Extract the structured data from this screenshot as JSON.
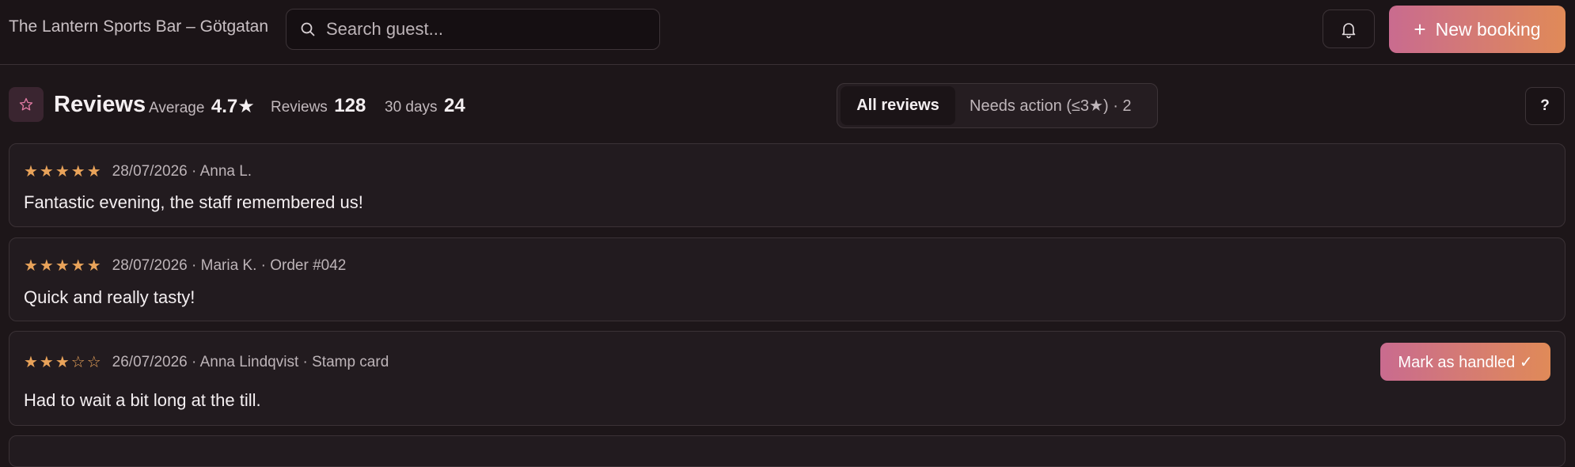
{
  "header": {
    "venue": "The Lantern Sports Bar – Götgatan",
    "search_placeholder": "Search guest...",
    "new_booking_label": "New booking",
    "new_booking_icon": "plus-icon",
    "bell_icon": "bell-icon"
  },
  "reviews_header": {
    "title": "Reviews",
    "average_label": "Average",
    "average_value": "4.7★",
    "reviews_label": "Reviews",
    "reviews_value": "128",
    "days_label": "30 days",
    "days_value": "24",
    "tabs": [
      {
        "label": "All reviews",
        "active": true
      },
      {
        "label": "Needs action (≤3★) · 2",
        "active": false
      }
    ],
    "help_label": "?"
  },
  "reviews": [
    {
      "stars": "★★★★★",
      "meta": "28/07/2026 · Anna L.",
      "text": "Fantastic evening, the staff remembered us!"
    },
    {
      "stars": "★★★★★",
      "meta": "28/07/2026 · Maria K. · Order #042",
      "text": "Quick and really tasty!"
    },
    {
      "stars": "★★★☆☆",
      "meta": "26/07/2026 · Anna Lindqvist · Stamp card",
      "text": "Had to wait a bit long at the till.",
      "action_label": "Mark as handled ✓"
    }
  ],
  "colors": {
    "accent_start": "#c96b8f",
    "accent_end": "#e08a58",
    "star": "#e9a35a",
    "background": "#1d1619"
  }
}
